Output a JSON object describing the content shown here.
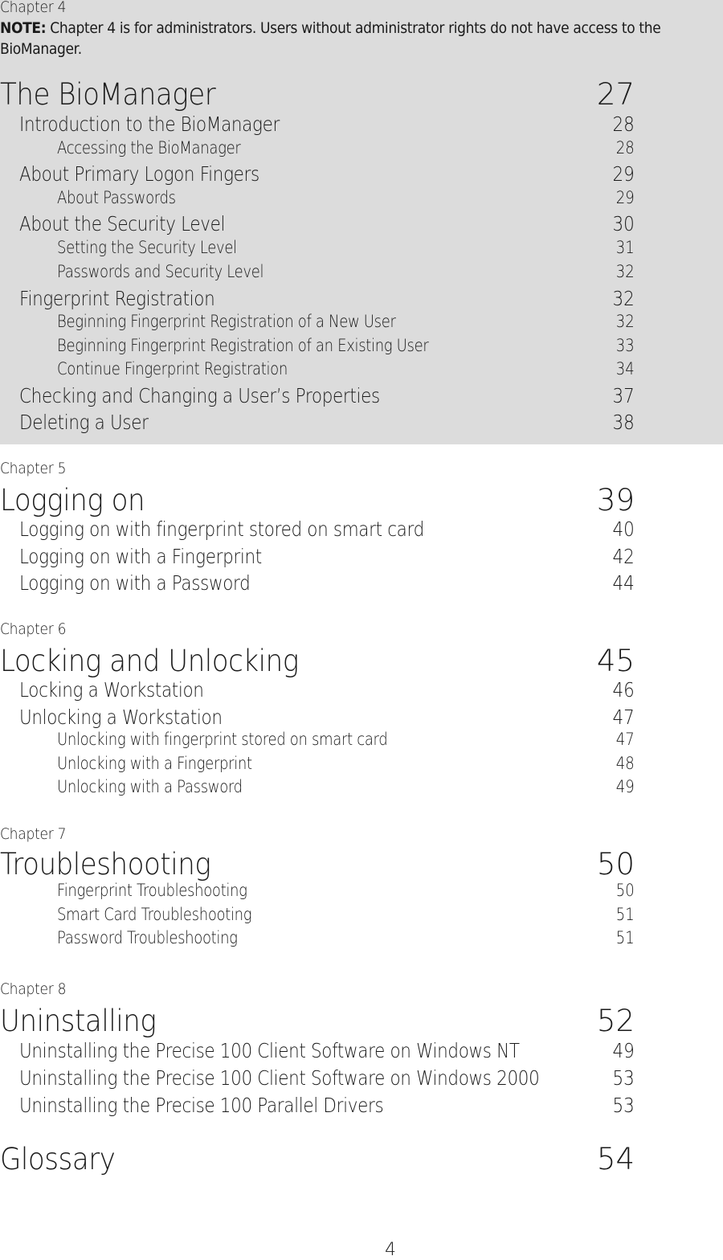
{
  "chapter4": {
    "label": "Chapter 4",
    "note_label": "NOTE:",
    "note_text": " Chapter 4 is for administrators. Users without administrator rights do not have access to the BioManager.",
    "title": "The BioManager",
    "page": "27",
    "entries": [
      {
        "level": 1,
        "text": "Introduction to the BioManager",
        "page": "28"
      },
      {
        "level": 2,
        "text": "Accessing the BioManager",
        "page": "28"
      },
      {
        "level": 1,
        "text": "About Primary Logon Fingers",
        "page": "29"
      },
      {
        "level": 2,
        "text": "About Passwords",
        "page": "29"
      },
      {
        "level": 1,
        "text": "About the Security Level",
        "page": "30"
      },
      {
        "level": 2,
        "text": "Setting the Security Level",
        "page": "31"
      },
      {
        "level": 2,
        "text": "Passwords and Security Level",
        "page": "32"
      },
      {
        "level": 1,
        "text": "Fingerprint Registration",
        "page": "32"
      },
      {
        "level": 2,
        "text": "Beginning Fingerprint Registration of a New User",
        "page": "32"
      },
      {
        "level": 2,
        "text": "Beginning Fingerprint Registration of an Existing User",
        "page": "33"
      },
      {
        "level": 2,
        "text": "Continue Fingerprint Registration",
        "page": "34"
      },
      {
        "level": 1,
        "text": "Checking and Changing a User’s Properties",
        "page": "37"
      },
      {
        "level": 1,
        "text": "Deleting a User",
        "page": "38"
      }
    ]
  },
  "chapter5": {
    "label": "Chapter 5",
    "title": "Logging on",
    "page": "39",
    "entries": [
      {
        "level": 1,
        "text": "Logging on with fingerprint stored on smart card",
        "page": "40"
      },
      {
        "level": 1,
        "text": "Logging on with a Fingerprint",
        "page": "42"
      },
      {
        "level": 1,
        "text": "Logging on with a Password",
        "page": "44"
      }
    ]
  },
  "chapter6": {
    "label": "Chapter 6",
    "title": "Locking and Unlocking",
    "page": "45",
    "entries": [
      {
        "level": 1,
        "text": "Locking a Workstation",
        "page": "46"
      },
      {
        "level": 1,
        "text": "Unlocking a Workstation",
        "page": "47"
      },
      {
        "level": 2,
        "text": "Unlocking with fingerprint stored on smart card",
        "page": "47"
      },
      {
        "level": 2,
        "text": "Unlocking with a Fingerprint",
        "page": "48"
      },
      {
        "level": 2,
        "text": "Unlocking with a Password",
        "page": "49"
      }
    ]
  },
  "chapter7": {
    "label": "Chapter 7",
    "title": "Troubleshooting",
    "page": "50",
    "entries": [
      {
        "level": 2,
        "text": "Fingerprint Troubleshooting",
        "page": "50"
      },
      {
        "level": 2,
        "text": "Smart Card Troubleshooting",
        "page": "51"
      },
      {
        "level": 2,
        "text": "Password Troubleshooting",
        "page": "51"
      }
    ]
  },
  "chapter8": {
    "label": "Chapter 8",
    "title": "Uninstalling",
    "page": "52",
    "entries": [
      {
        "level": 1,
        "text": "Uninstalling the Precise 100 Client Software on Windows NT",
        "page": "49"
      },
      {
        "level": 1,
        "text": "Uninstalling the Precise 100 Client Software on Windows 2000",
        "page": "53"
      },
      {
        "level": 1,
        "text": "Uninstalling the Precise 100 Parallel Drivers",
        "page": "53"
      }
    ]
  },
  "glossary": {
    "title": "Glossary",
    "page": "54"
  },
  "footer": {
    "page_number": "4"
  }
}
